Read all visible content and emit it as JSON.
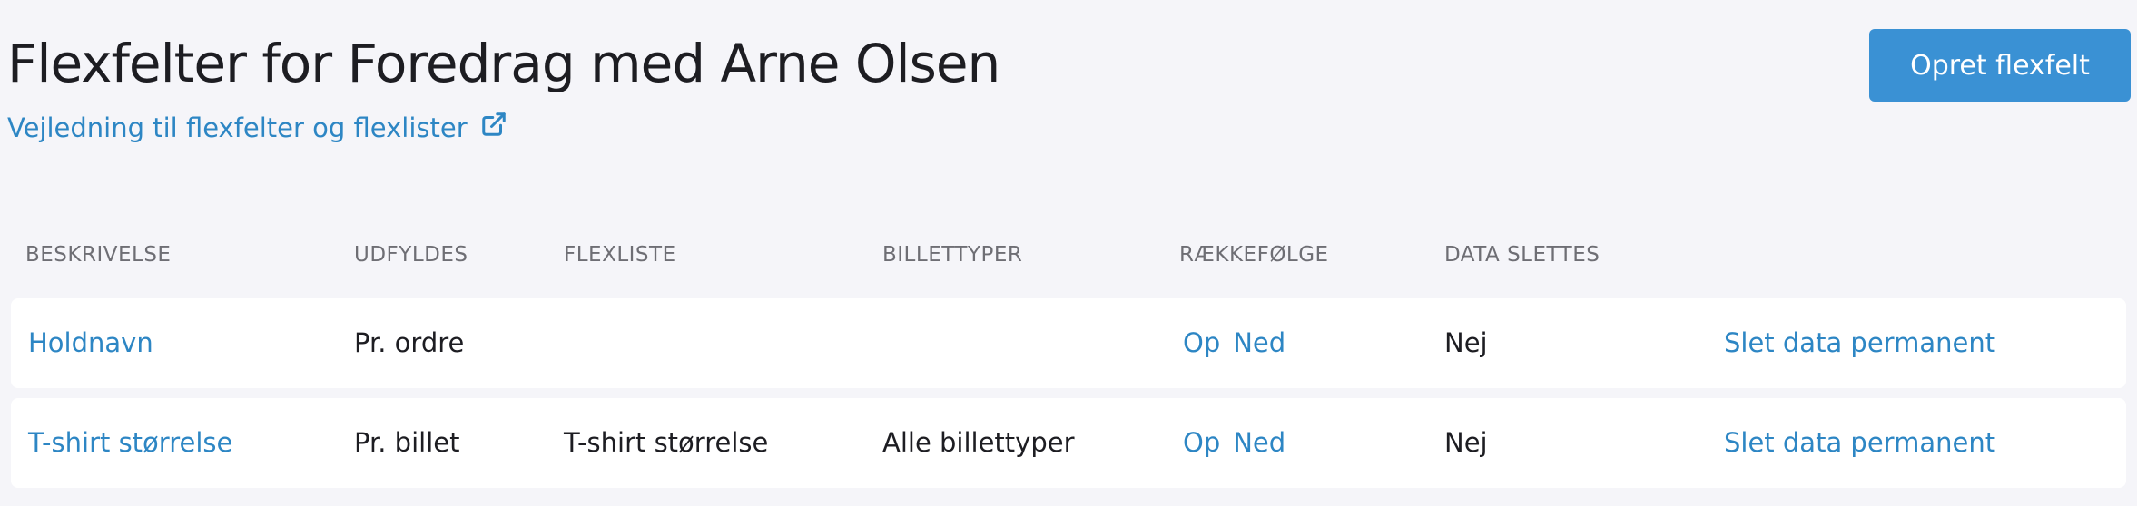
{
  "header": {
    "title": "Flexfelter for Foredrag med Arne Olsen",
    "guide_link": "Vejledning til flexfelter og flexlister",
    "create_button": "Opret flexfelt"
  },
  "table": {
    "columns": {
      "description": "BESKRIVELSE",
      "filled": "UDFYLDES",
      "flexlist": "FLEXLISTE",
      "ticket_types": "BILLETTYPER",
      "order": "RÆKKEFØLGE",
      "data_deleted": "DATA SLETTES"
    },
    "rows": [
      {
        "description": "Holdnavn",
        "filled": "Pr. ordre",
        "flexlist": "",
        "ticket_types": "",
        "up": "Op",
        "down": "Ned",
        "data_deleted": "Nej",
        "delete_action": "Slet data permanent"
      },
      {
        "description": "T-shirt størrelse",
        "filled": "Pr. billet",
        "flexlist": "T-shirt størrelse",
        "ticket_types": "Alle billettyper",
        "up": "Op",
        "down": "Ned",
        "data_deleted": "Nej",
        "delete_action": "Slet data permanent"
      }
    ]
  },
  "colors": {
    "link": "#2d86c4",
    "button": "#3a91d4",
    "background": "#f5f5f9"
  },
  "icons": {
    "guide_link_icon": "external-link-icon"
  }
}
